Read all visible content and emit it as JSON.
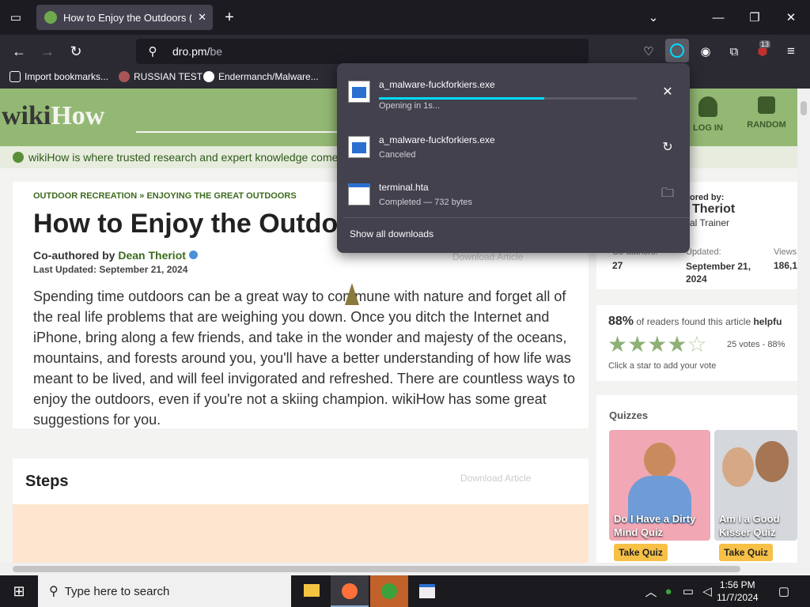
{
  "tab": {
    "title": "How to Enjoy the Outdoors (wit"
  },
  "url": {
    "domain": "dro.pm/",
    "path": "be"
  },
  "bookmarks": [
    "Import bookmarks...",
    "RUSSIAN TEST",
    "Endermanch/Malware..."
  ],
  "toolbar": {
    "extension_badge": "13"
  },
  "downloads": {
    "items": [
      {
        "name": "a_malware-fuckforkiers.exe",
        "status": "Opening in 1s...",
        "progress": 0.64
      },
      {
        "name": "a_malware-fuckforkiers.exe",
        "status": "Canceled"
      },
      {
        "name": "terminal.hta",
        "status": "Completed — 732 bytes"
      }
    ],
    "show_all": "Show all downloads"
  },
  "site": {
    "logo_wiki": "wiki",
    "logo_how": "How",
    "nav_login": "LOG IN",
    "nav_random": "RANDOM",
    "trust": "wikiHow is where trusted research and expert knowledge come"
  },
  "article": {
    "crumb1": "OUTDOOR RECREATION",
    "crumb_sep": "»",
    "crumb2": "ENJOYING THE GREAT OUTDOORS",
    "title": "How to Enjoy the Outdo",
    "coauth_prefix": "Co-authored by",
    "author": "Dean Theriot",
    "updated": "Last Updated: September 21, 2024",
    "download": "Download Article",
    "intro": "Spending time outdoors can be a great way to commune with nature and forget all of the real life problems that are weighing you down. Once you ditch the Internet and iPhone, bring along a few friends, and take in the wonder and majesty of the oceans, mountains, and forests around you, you'll have a better understanding of how life was meant to be lived, and will feel invigorated and refreshed. There are countless ways to enjoy the outdoors, even if you're not a skiing champion. wikiHow has some great suggestions for you.",
    "steps": "Steps"
  },
  "sidebar": {
    "cored_by": "ored by:",
    "author_last": "Theriot",
    "role": "al Trainer",
    "coauthors_label": "Co-authors:",
    "coauthors": "27",
    "updated_label": "Updated:",
    "updated": "September 21, 2024",
    "views_label": "Views",
    "views": "186,1",
    "helpful_pct": "88%",
    "helpful_text": "of readers found this article",
    "helpful_word": "helpfu",
    "rating": 4.4,
    "votes": "25 votes - 88%",
    "rate_hint": "Click a star to add your vote",
    "quizzes": "Quizzes",
    "quiz1": "Do I Have a Dirty Mind Quiz",
    "quiz2": "Am I a Good Kisser Quiz",
    "take_quiz": "Take Quiz"
  },
  "taskbar": {
    "search_placeholder": "Type here to search",
    "time": "1:56 PM",
    "date": "11/7/2024"
  }
}
